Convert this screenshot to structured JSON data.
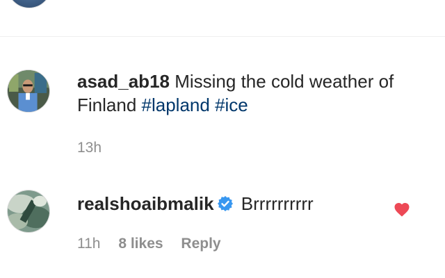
{
  "comments": [
    {
      "username": "asad_ab18",
      "text": "Missing the cold weather of Finland",
      "hashtags": [
        "#lapland",
        "#ice"
      ],
      "time": "13h"
    },
    {
      "username": "realshoaibmalik",
      "verified": true,
      "text": "Brrrrrrrrrr",
      "time": "11h",
      "likes": "8 likes",
      "reply": "Reply",
      "liked": true
    }
  ],
  "colors": {
    "text": "#262626",
    "muted": "#8e8e8e",
    "hashtag": "#00376b",
    "verified": "#3897f0",
    "heart": "#ed4956",
    "divider": "#efefef"
  }
}
